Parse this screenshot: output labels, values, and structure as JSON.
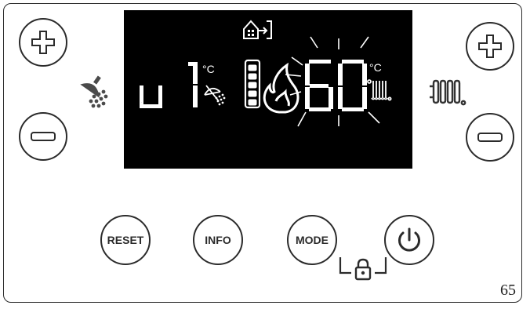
{
  "panel": {
    "page_number": "65"
  },
  "display": {
    "dhw_mode_letter": "u",
    "dhw_setpoint": "1",
    "dhw_unit": "°C",
    "heating_setpoint": "60",
    "heating_unit": "°C",
    "flame_level": 5,
    "flame_level_max": 5,
    "status_icons": [
      "outdoor-sensor-icon",
      "tap-shower-icon",
      "flame-icon",
      "radiator-icon"
    ]
  },
  "buttons": {
    "reset_label": "RESET",
    "info_label": "INFO",
    "mode_label": "MODE"
  },
  "icons": {
    "dhw_side": "shower-icon",
    "heating_side": "radiator-icon",
    "power": "power-icon",
    "lock": "padlock-icon"
  },
  "colors": {
    "display_bg": "#000000",
    "segment_on": "#ffffff",
    "outline": "#2b2b2b"
  }
}
